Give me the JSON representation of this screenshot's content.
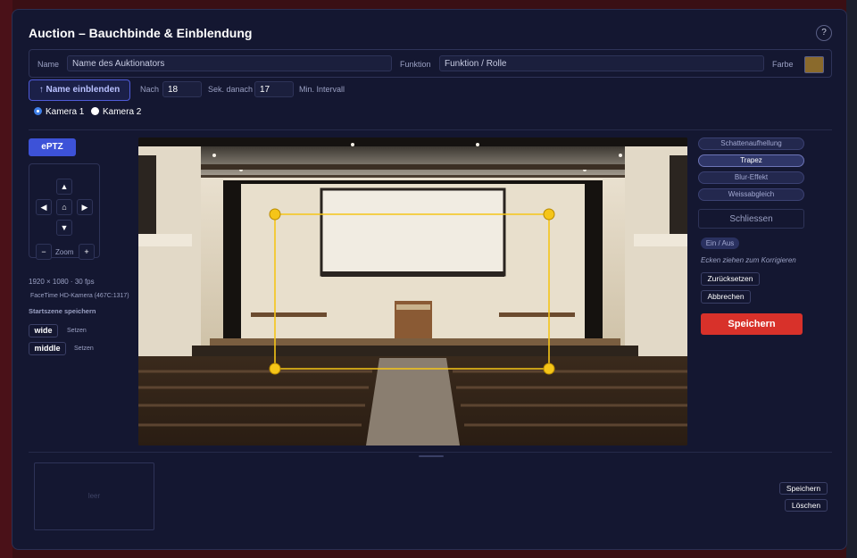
{
  "dialog": {
    "title": "Auction – Bauchbinde & Einblendung",
    "help": "?"
  },
  "row1": {
    "name_label": "Name",
    "name_placeholder": "Name des Auktionators",
    "funktion_label": "Funktion",
    "funktion_placeholder": "Funktion / Rolle",
    "farbe_label": "Farbe",
    "farbe_color": "#8a6a2c"
  },
  "row2": {
    "show_button": "↑ Name einblenden",
    "nach_label": "Nach",
    "nach_value": "18",
    "sek_label": "Sek. danach",
    "interval_value": "17",
    "interval_label": "Min. Intervall"
  },
  "cameras": [
    {
      "label": "Kamera 1",
      "selected": true
    },
    {
      "label": "Kamera 2",
      "selected": false
    }
  ],
  "ptz": {
    "eptz_label": "ePTZ",
    "up": "▲",
    "down": "▼",
    "left": "◀",
    "right": "▶",
    "home": "⌂",
    "zoom_minus": "−",
    "zoom_label": "Zoom",
    "zoom_plus": "+",
    "resolution": "1920 × 1080 · 30 fps",
    "camera_name": "FaceTime HD-Kamera (467C:1317)",
    "startscene_label": "Startszene speichern",
    "scenes": [
      {
        "name": "wide",
        "action": "Setzen"
      },
      {
        "name": "middle",
        "action": "Setzen"
      }
    ]
  },
  "effects": {
    "items": [
      {
        "label": "Schattenaufhellung",
        "active": false
      },
      {
        "label": "Trapez",
        "active": true
      },
      {
        "label": "Blur-Effekt",
        "active": false
      },
      {
        "label": "Weissabgleich",
        "active": false
      }
    ],
    "close_label": "Schliessen",
    "toggle_label": "Ein / Aus",
    "hint": "Ecken ziehen zum Korrigieren",
    "reset_label": "Zurücksetzen",
    "cancel_label": "Abbrechen",
    "save_label": "Speichern"
  },
  "bottom": {
    "empty_label": "leer",
    "save_label": "Speichern",
    "delete_label": "Löschen"
  },
  "colors": {
    "accent": "#3d52d8",
    "save": "#d8312a",
    "handle": "#f5c518"
  }
}
